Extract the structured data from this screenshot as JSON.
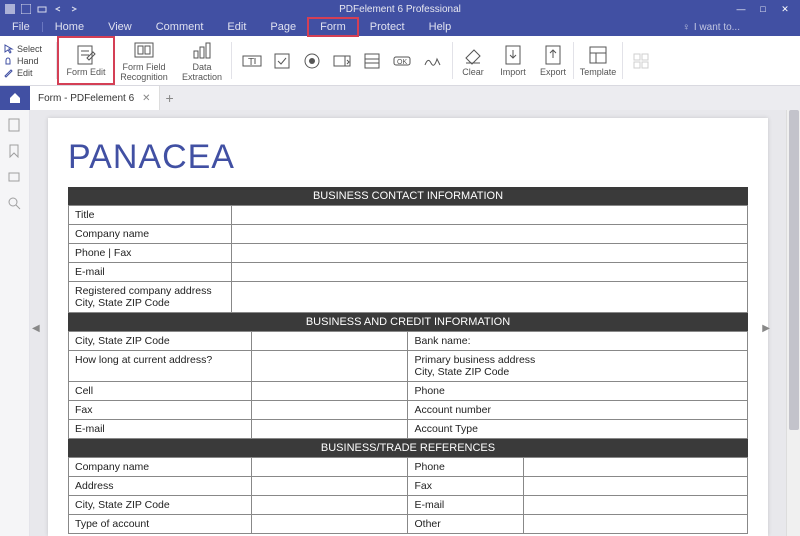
{
  "app": {
    "title": "PDFelement 6 Professional"
  },
  "menu": {
    "file": "File",
    "home": "Home",
    "view": "View",
    "comment": "Comment",
    "edit": "Edit",
    "page": "Page",
    "form": "Form",
    "protect": "Protect",
    "help": "Help",
    "want": "I want to..."
  },
  "tools": {
    "select": "Select",
    "hand": "Hand",
    "edit": "Edit"
  },
  "ribbon": {
    "form_edit": "Form Edit",
    "form_field_recog": "Form Field\nRecognition",
    "data_extract": "Data Extraction",
    "clear": "Clear",
    "import": "Import",
    "export": "Export",
    "template": "Template"
  },
  "tab": {
    "name": "Form - PDFelement 6"
  },
  "doc": {
    "logo": "PANACEA",
    "sec1": "BUSINESS CONTACT INFORMATION",
    "s1_title": "Title",
    "s1_company": "Company name",
    "s1_phonefax": "Phone | Fax",
    "s1_email": "E-mail",
    "s1_addr": "Registered company address\nCity, State ZIP Code",
    "sec2": "BUSINESS AND CREDIT INFORMATION",
    "s2_city": "City, State ZIP Code",
    "s2_bank": "Bank name:",
    "s2_howlong": "How long at current address?",
    "s2_primaddr": "Primary business address\nCity, State ZIP Code",
    "s2_cell": "Cell",
    "s2_phone": "Phone",
    "s2_fax": "Fax",
    "s2_acctnum": "Account number",
    "s2_email": "E-mail",
    "s2_accttype": "Account Type",
    "sec3": "BUSINESS/TRADE REFERENCES",
    "s3_company": "Company name",
    "s3_phone": "Phone",
    "s3_address": "Address",
    "s3_fax": "Fax",
    "s3_city": "City, State ZIP Code",
    "s3_email": "E-mail",
    "s3_type": "Type of account",
    "s3_other": "Other"
  }
}
